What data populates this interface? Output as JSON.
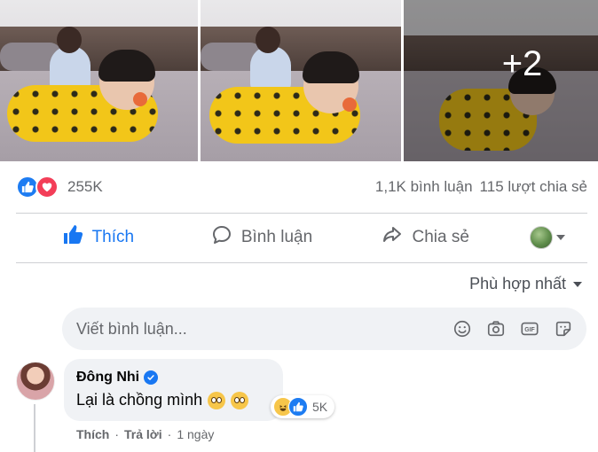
{
  "photos": {
    "items": [
      {
        "alt": "baby-lying-on-bed-1"
      },
      {
        "alt": "baby-lying-on-bed-2"
      },
      {
        "alt": "baby-crawling-on-bed"
      }
    ],
    "more_count": "+2"
  },
  "stats": {
    "reaction_icons": [
      "like-reaction-icon",
      "love-reaction-icon"
    ],
    "reaction_count": "255K",
    "comments": "1,1K bình luận",
    "shares": "115 lượt chia sẻ"
  },
  "actions": {
    "like_label": "Thích",
    "comment_label": "Bình luận",
    "share_label": "Chia sẻ"
  },
  "sort": {
    "label": "Phù hợp nhất"
  },
  "composer": {
    "placeholder": "Viết bình luận..."
  },
  "comment": {
    "author": "Đông Nhi",
    "text": "Lại là chồng mình",
    "reaction_count": "5K",
    "like_label": "Thích",
    "reply_label": "Trả lời",
    "separator": "·",
    "time": "1 ngày"
  },
  "colors": {
    "accent": "#1877f2",
    "like_blue": "#1d7cf2",
    "love_red": "#f33e58",
    "muted_text": "#65676b",
    "bubble_bg": "#f0f2f5"
  }
}
